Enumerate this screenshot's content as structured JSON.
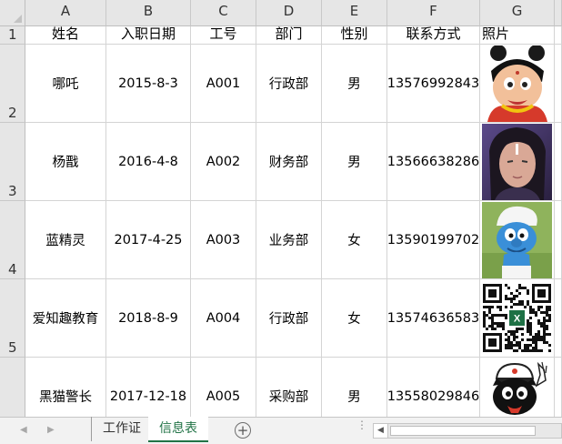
{
  "grid": {
    "columns": [
      "A",
      "B",
      "C",
      "D",
      "E",
      "F",
      "G"
    ],
    "row_numbers": [
      "1",
      "2",
      "3",
      "4",
      "5",
      ""
    ],
    "header": [
      "姓名",
      "入职日期",
      "工号",
      "部门",
      "性别",
      "联系方式",
      "照片"
    ],
    "rows": [
      {
        "name": "哪吒",
        "date": "2015-8-3",
        "id": "A001",
        "dept": "行政部",
        "gender": "男",
        "phone": "13576992843",
        "photo": "nezha-cartoon-portrait"
      },
      {
        "name": "杨戬",
        "date": "2016-4-8",
        "id": "A002",
        "dept": "财务部",
        "gender": "男",
        "phone": "13566638286",
        "photo": "yang-jian-actor-portrait"
      },
      {
        "name": "蓝精灵",
        "date": "2017-4-25",
        "id": "A003",
        "dept": "业务部",
        "gender": "女",
        "phone": "13590199702",
        "photo": "smurf-cartoon-image"
      },
      {
        "name": "爱知趣教育",
        "date": "2018-8-9",
        "id": "A004",
        "dept": "行政部",
        "gender": "女",
        "phone": "13574636583",
        "photo": "qr-code-with-excel-logo"
      },
      {
        "name": "黑猫警长",
        "date": "2017-12-18",
        "id": "A005",
        "dept": "采购部",
        "gender": "男",
        "phone": "13558029846",
        "photo": "black-cat-detective-cartoon"
      }
    ]
  },
  "sheet_tabs": {
    "tabs": [
      "工作证",
      "信息表"
    ],
    "active": "信息表"
  },
  "colors": {
    "header_bg": "#e6e6e6",
    "active_tab_green": "#217346",
    "grid_line": "#d4d4d4"
  },
  "icons": {
    "prev_sheet": "triangle-left-icon",
    "next_sheet": "triangle-right-icon",
    "add_sheet": "plus-circle-icon",
    "scroll_left": "scroll-left-arrow-icon"
  }
}
